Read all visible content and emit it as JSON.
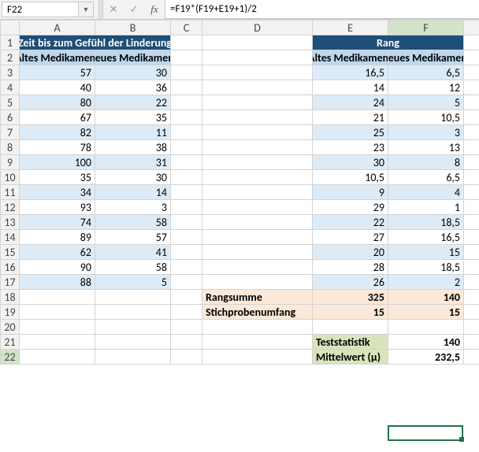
{
  "namebox": "F22",
  "formula": "=F19*(F19+E19+1)/2",
  "columns": [
    "A",
    "B",
    "C",
    "D",
    "E",
    "F"
  ],
  "headers": {
    "left_title": "Zeit bis zum Gefühl der Linderung",
    "right_title": "Rang",
    "altes": "Altes Medikament",
    "neues": "Neues Medikament"
  },
  "rows": [
    {
      "r": 3,
      "a": "57",
      "b": "30",
      "e": "16,5",
      "f": "6,5"
    },
    {
      "r": 4,
      "a": "40",
      "b": "36",
      "e": "14",
      "f": "12"
    },
    {
      "r": 5,
      "a": "80",
      "b": "22",
      "e": "24",
      "f": "5"
    },
    {
      "r": 6,
      "a": "67",
      "b": "35",
      "e": "21",
      "f": "10,5"
    },
    {
      "r": 7,
      "a": "82",
      "b": "11",
      "e": "25",
      "f": "3"
    },
    {
      "r": 8,
      "a": "78",
      "b": "38",
      "e": "23",
      "f": "13"
    },
    {
      "r": 9,
      "a": "100",
      "b": "31",
      "e": "30",
      "f": "8"
    },
    {
      "r": 10,
      "a": "35",
      "b": "30",
      "e": "10,5",
      "f": "6,5"
    },
    {
      "r": 11,
      "a": "34",
      "b": "14",
      "e": "9",
      "f": "4"
    },
    {
      "r": 12,
      "a": "93",
      "b": "3",
      "e": "29",
      "f": "1"
    },
    {
      "r": 13,
      "a": "74",
      "b": "58",
      "e": "22",
      "f": "18,5"
    },
    {
      "r": 14,
      "a": "89",
      "b": "57",
      "e": "27",
      "f": "16,5"
    },
    {
      "r": 15,
      "a": "62",
      "b": "41",
      "e": "20",
      "f": "15"
    },
    {
      "r": 16,
      "a": "90",
      "b": "58",
      "e": "28",
      "f": "18,5"
    },
    {
      "r": 17,
      "a": "88",
      "b": "5",
      "e": "26",
      "f": "2"
    }
  ],
  "rangsummeLabel": "Rangsumme",
  "rangsummeE": "325",
  "rangsummeF": "140",
  "stichLabel": "Stichprobenumfang",
  "stichE": "15",
  "stichF": "15",
  "teststatLabel": "Teststatistik",
  "teststatVal": "140",
  "mittelwertLabel": "Mittelwert (μ)",
  "mittelwertVal": "232,5"
}
